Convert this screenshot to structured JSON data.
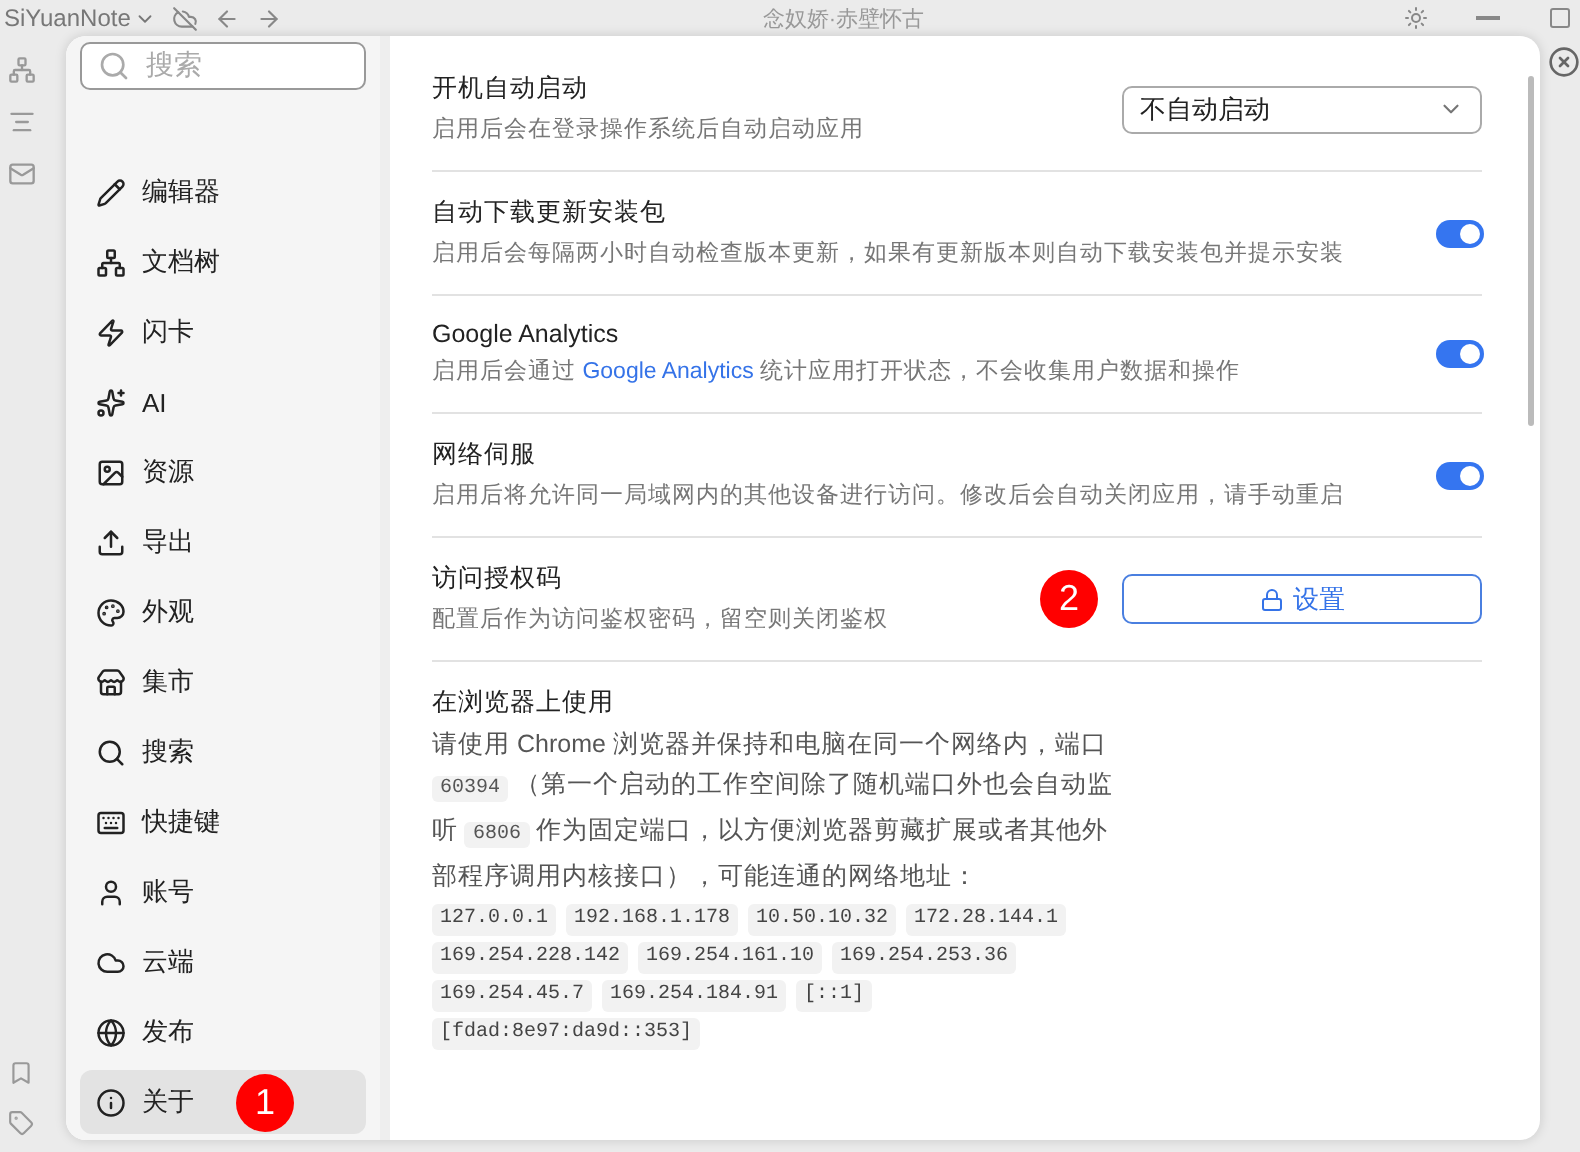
{
  "title_bar": {
    "app_name": "SiYuanNote",
    "title": "念奴娇·赤壁怀古"
  },
  "search": {
    "placeholder": "搜索"
  },
  "sidebar": {
    "items": [
      {
        "label": "编辑器",
        "selected": false
      },
      {
        "label": "文档树",
        "selected": false
      },
      {
        "label": "闪卡",
        "selected": false
      },
      {
        "label": "AI",
        "selected": false
      },
      {
        "label": "资源",
        "selected": false
      },
      {
        "label": "导出",
        "selected": false
      },
      {
        "label": "外观",
        "selected": false
      },
      {
        "label": "集市",
        "selected": false
      },
      {
        "label": "搜索",
        "selected": false
      },
      {
        "label": "快捷键",
        "selected": false
      },
      {
        "label": "账号",
        "selected": false
      },
      {
        "label": "云端",
        "selected": false
      },
      {
        "label": "发布",
        "selected": false
      },
      {
        "label": "关于",
        "selected": true,
        "badge": "1"
      }
    ]
  },
  "settings": [
    {
      "kind": "select",
      "title": "开机自动启动",
      "description": [
        {
          "kind": "text",
          "text": "启用后会在登录操作系统后自动启动应用"
        }
      ],
      "value": "不自动启动"
    },
    {
      "kind": "toggle",
      "title": "自动下载更新安装包",
      "description": [
        {
          "kind": "text",
          "text": "启用后会每隔两小时自动检查版本更新，如果有更新版本则自动下载安装包并提示安装"
        }
      ],
      "on": true
    },
    {
      "kind": "toggle",
      "title": "Google Analytics",
      "description": [
        {
          "kind": "text",
          "text": "启用后会通过 "
        },
        {
          "kind": "link",
          "text": "Google Analytics"
        },
        {
          "kind": "text",
          "text": " 统计应用打开状态，不会收集用户数据和操作"
        }
      ],
      "on": true
    },
    {
      "kind": "toggle",
      "title": "网络伺服",
      "description": [
        {
          "kind": "text",
          "text": "启用后将允许同一局域网内的其他设备进行访问。修改后会自动关闭应用，请手动重启"
        }
      ],
      "on": true
    },
    {
      "kind": "button",
      "title": "访问授权码",
      "description": [
        {
          "kind": "text",
          "text": "配置后作为访问鉴权密码，留空则关闭鉴权"
        }
      ],
      "button": "设置",
      "badge": "2"
    }
  ],
  "browser_usage": {
    "title": "在浏览器上使用",
    "paragraph": [
      {
        "kind": "text",
        "text": "请使用 Chrome 浏览器并保持和电脑在同一个网络内，端口 "
      },
      {
        "kind": "code",
        "text": "60394"
      },
      {
        "kind": "text",
        "text": " （第一个启动的工作空间除了随机端口外也会自动监听 "
      },
      {
        "kind": "code",
        "text": "6806"
      },
      {
        "kind": "text",
        "text": " 作为固定端口，以方便浏览器剪藏扩展或者其他外部程序调用内核接口），可能连通的网络地址："
      }
    ],
    "addresses": [
      "127.0.0.1",
      "192.168.1.178",
      "10.50.10.32",
      "172.28.144.1",
      "169.254.228.142",
      "169.254.161.10",
      "169.254.253.36",
      "169.254.45.7",
      "169.254.184.91",
      "[::1]",
      "[fdad:8e97:da9d::353]"
    ]
  }
}
